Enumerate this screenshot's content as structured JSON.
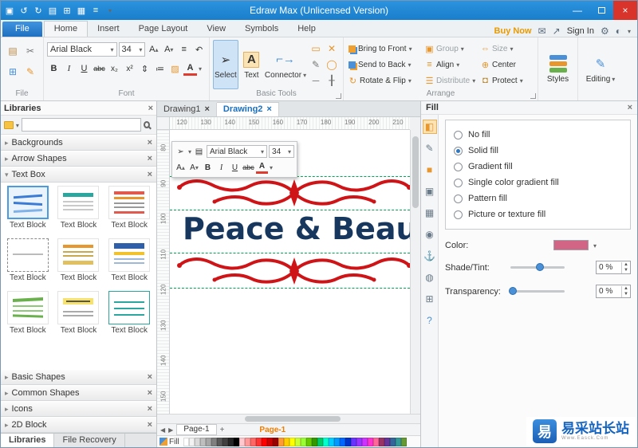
{
  "titlebar": {
    "title": "Edraw Max (Unlicensed Version)"
  },
  "tabs": {
    "file": "File",
    "home": "Home",
    "insert": "Insert",
    "page_layout": "Page Layout",
    "view": "View",
    "symbols": "Symbols",
    "help": "Help",
    "buy_now": "Buy Now",
    "sign_in": "Sign In"
  },
  "ribbon": {
    "font_name": "Arial Black",
    "font_size": "34",
    "bold": "B",
    "italic": "I",
    "underline": "U",
    "strike": "abc",
    "subscript": "x₂",
    "superscript": "x²",
    "select_label": "Select",
    "text_label": "Text",
    "text_icon": "A",
    "connector_label": "Connector",
    "arrange": {
      "bring_to_front": "Bring to Front",
      "group": "Group",
      "size": "Size",
      "send_to_back": "Send to Back",
      "align": "Align",
      "center": "Center",
      "rotate_flip": "Rotate & Flip",
      "distribute": "Distribute",
      "protect": "Protect"
    },
    "styles_label": "Styles",
    "editing_label": "Editing",
    "groups": {
      "file": "File",
      "font": "Font",
      "basic_tools": "Basic Tools",
      "arrange": "Arrange"
    }
  },
  "libraries": {
    "title": "Libraries",
    "search_value": "",
    "sections_top": [
      "Backgrounds",
      "Arrow Shapes",
      "Text Box"
    ],
    "text_block_caption": "Text Block",
    "sections_bottom": [
      "Basic Shapes",
      "Common Shapes",
      "Icons",
      "2D Block"
    ],
    "tab_libraries": "Libraries",
    "tab_file_recovery": "File Recovery"
  },
  "canvas": {
    "tab1": "Drawing1",
    "tab2": "Drawing2",
    "ruler_h": [
      "120",
      "130",
      "140",
      "150",
      "160",
      "170",
      "180",
      "190",
      "200",
      "210"
    ],
    "ruler_v": [
      "80",
      "90",
      "100",
      "110",
      "120",
      "130",
      "140",
      "150"
    ],
    "mini_font_name": "Arial Black",
    "mini_font_size": "34",
    "shape_text": "Peace & Beaut",
    "page_tab": "Page-1",
    "page_active": "Page-1",
    "fill_label": "Fill"
  },
  "fill_panel": {
    "title": "Fill",
    "options": [
      {
        "label": "No fill",
        "selected": false
      },
      {
        "label": "Solid fill",
        "selected": true
      },
      {
        "label": "Gradient fill",
        "selected": false
      },
      {
        "label": "Single color gradient fill",
        "selected": false
      },
      {
        "label": "Pattern fill",
        "selected": false
      },
      {
        "label": "Picture or texture fill",
        "selected": false
      }
    ],
    "color_label": "Color:",
    "color_hex": "#d26586",
    "shade_label": "Shade/Tint:",
    "shade_value": "0 %",
    "transparency_label": "Transparency:",
    "transparency_value": "0 %"
  },
  "colors": {
    "titlebar_blue": "#1a7ecb",
    "buy_now_orange": "#e89a02",
    "ornament_red": "#cf1418",
    "shape_text_navy": "#17375e",
    "guide_green": "#00a651",
    "page_tab_orange": "#f07d00"
  },
  "palette": [
    "#ffffff",
    "#f2f2f2",
    "#d9d9d9",
    "#bfbfbf",
    "#a6a6a6",
    "#808080",
    "#595959",
    "#404040",
    "#262626",
    "#000000",
    "#ffc7ce",
    "#ff9999",
    "#ff6666",
    "#ff3333",
    "#ff0000",
    "#cc0000",
    "#990000",
    "#ff9933",
    "#ffcc00",
    "#ffff00",
    "#ccff33",
    "#99ff33",
    "#66cc00",
    "#339900",
    "#00cc66",
    "#00ffcc",
    "#00ccff",
    "#0099ff",
    "#0066ff",
    "#0033cc",
    "#6633ff",
    "#9933ff",
    "#cc33ff",
    "#ff33cc",
    "#ff6699",
    "#993366",
    "#663399",
    "#336699",
    "#339999",
    "#669933"
  ],
  "watermark": {
    "logo": "易",
    "text": "易采站长站",
    "subtext": "Www.Easck.Com"
  }
}
